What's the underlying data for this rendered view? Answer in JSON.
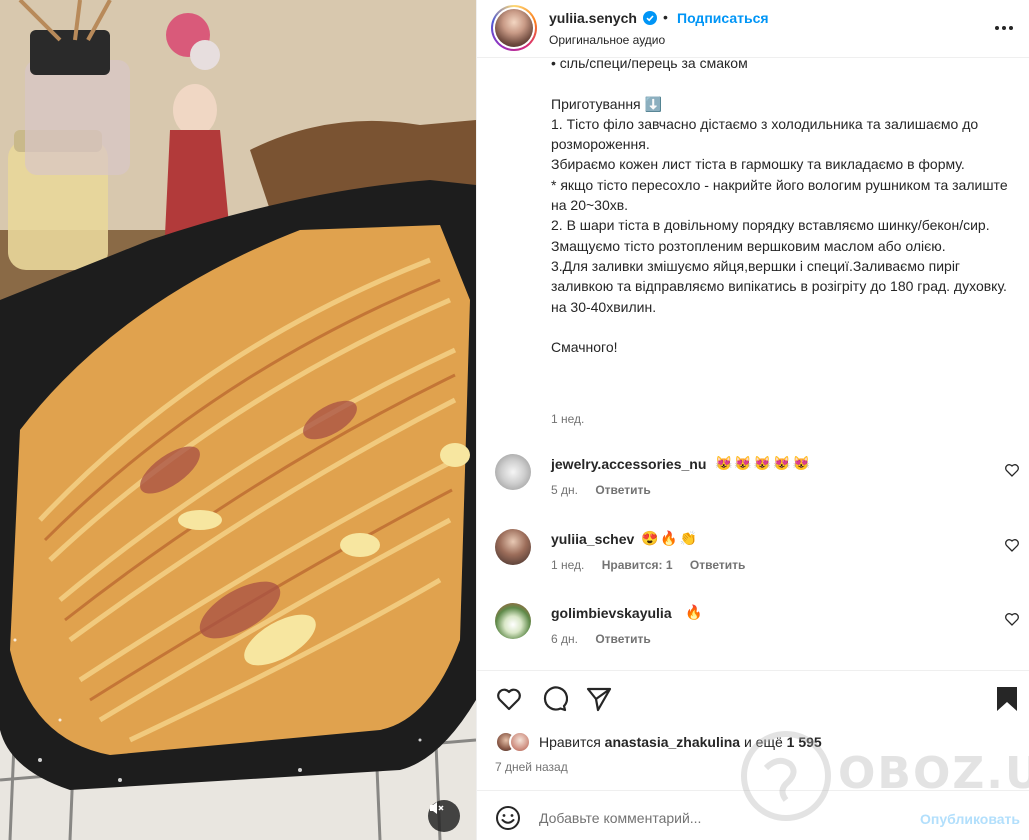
{
  "post": {
    "username": "yuliia.senych",
    "separator": "•",
    "follow_label": "Подписаться",
    "audio_label": "Оригинальное аудио",
    "caption": "• сіль/специ/перець за смаком\n\nПриготування ⬇️\n1. Тісто філо завчасно дістаємо з холодильника та залишаємо до розмороження.\nЗбираємо кожен лист тіста в гармошку та викладаємо в форму.\n* якщо тісто пересохло - накрийте його вологим рушником та залиште на 20~30хв.\n2. В шари тіста в довільному порядку вставляємо шинку/бекон/сир.\nЗмащуємо тісто розтопленим вершковим маслом або олією.\n3.Для заливки змішуємо яйця,вершки і специї.Заливаємо пиріг заливкою та відправляємо випікатись в розігріту до 180 град. духовку. на 30-40хвилин.\n\nСмачного!",
    "caption_time": "1 нед."
  },
  "comments": [
    {
      "user": "jewelry.accessories_nu",
      "text": "😻😻😻😻😻",
      "time": "5 дн.",
      "likes": "",
      "reply": "Ответить"
    },
    {
      "user": "yuliia_schev",
      "text": "😍🔥👏",
      "time": "1 нед.",
      "likes": "Нравится: 1",
      "reply": "Ответить"
    },
    {
      "user": "golimbievskayulia",
      "text": "🔥",
      "time": "6 дн.",
      "likes": "",
      "reply": "Ответить"
    }
  ],
  "likes": {
    "prefix": "Нравится ",
    "user": "anastasia_zhakulina",
    "middle": " и ещё ",
    "count": "1 595"
  },
  "time_ago": "7 дней назад",
  "add_comment": {
    "placeholder": "Добавьте комментарий...",
    "publish_label": "Опубликовать"
  },
  "watermark": "OBOZ.UA",
  "colors": {
    "accent": "#0095f6",
    "publish_disabled": "#b2dffc",
    "muted_text": "#737373"
  }
}
